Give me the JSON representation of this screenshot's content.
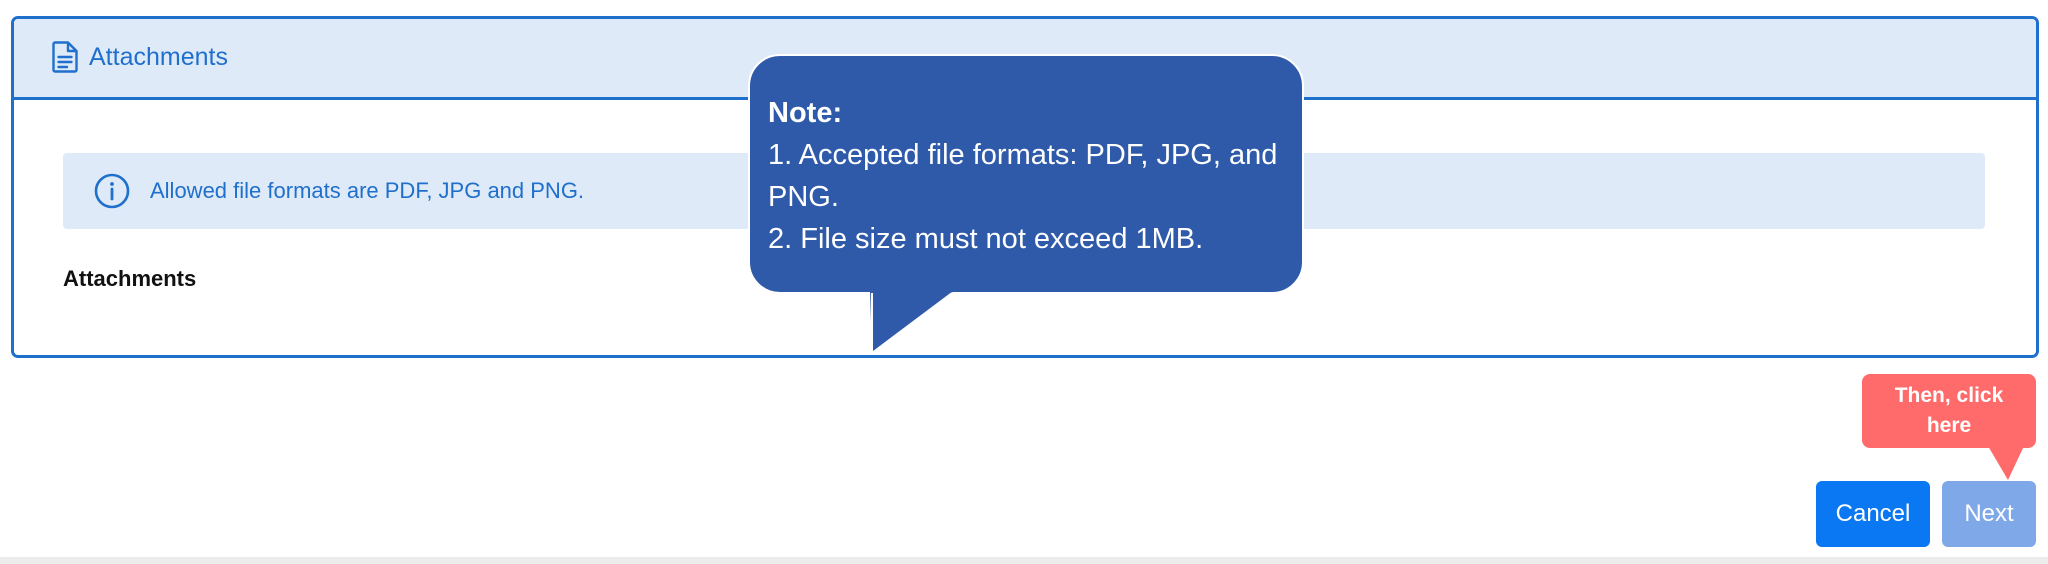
{
  "panel": {
    "title": "Attachments",
    "icon": "document-icon"
  },
  "info": {
    "icon": "info-icon",
    "text": "Allowed file formats are PDF, JPG and PNG."
  },
  "attachments": {
    "heading": "Attachments"
  },
  "note_callout": {
    "title": "Note:",
    "line1": "1. Accepted file formats: PDF, JPG, and PNG.",
    "line2": "2. File size must not exceed 1MB.",
    "color": "#2f5aaa"
  },
  "hint_callout": {
    "text": "Then, click here",
    "color": "#ff6b6b"
  },
  "buttons": {
    "cancel_label": "Cancel",
    "next_label": "Next"
  },
  "colors": {
    "primary": "#1f6fcc",
    "header_bg": "#deeaf7",
    "cancel_bg": "#0a78f2",
    "next_bg": "#7fa8e8"
  }
}
